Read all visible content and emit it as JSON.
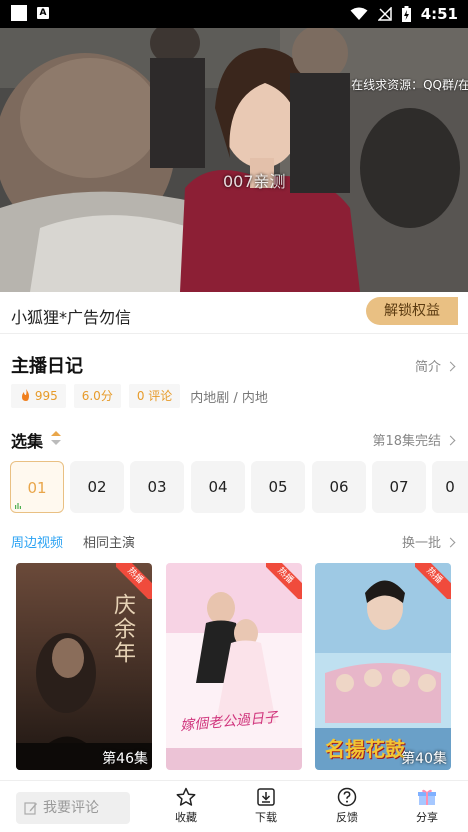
{
  "status_bar": {
    "time": "4:51",
    "badge": "A"
  },
  "video": {
    "overlay_text": "在线求资源：QQ群/在",
    "watermark": "007亲测"
  },
  "promo": {
    "title": "小狐狸*广告勿信",
    "unlock_label": "解锁权益"
  },
  "show": {
    "title": "主播日记",
    "intro_label": "简介",
    "heat": "995",
    "score": "6.0分",
    "comments": "0 评论",
    "region": "内地剧 / 内地"
  },
  "episodes": {
    "heading": "选集",
    "status": "第18集完结",
    "items": [
      "01",
      "02",
      "03",
      "04",
      "05",
      "06",
      "07",
      "0"
    ]
  },
  "related": {
    "tab_nearby": "周边视频",
    "tab_cast": "相同主演",
    "refresh_label": "换一批",
    "cards": [
      {
        "badge": "热播",
        "episodes": "第46集",
        "poster_text": "庆余年"
      },
      {
        "badge": "热播",
        "episodes": "",
        "poster_text": "嫁個老公過日子"
      },
      {
        "badge": "热播",
        "episodes": "第40集",
        "poster_text": "名揚花鼓"
      }
    ]
  },
  "bottom_bar": {
    "comment_placeholder": "我要评论",
    "favorite": "收藏",
    "download": "下载",
    "feedback": "反馈",
    "share": "分享"
  },
  "colors": {
    "accent_gold": "#e9c083",
    "tab_blue": "#2aa2f3",
    "tag_orange": "#e79b2a",
    "hot_red": "#f04b3c"
  }
}
